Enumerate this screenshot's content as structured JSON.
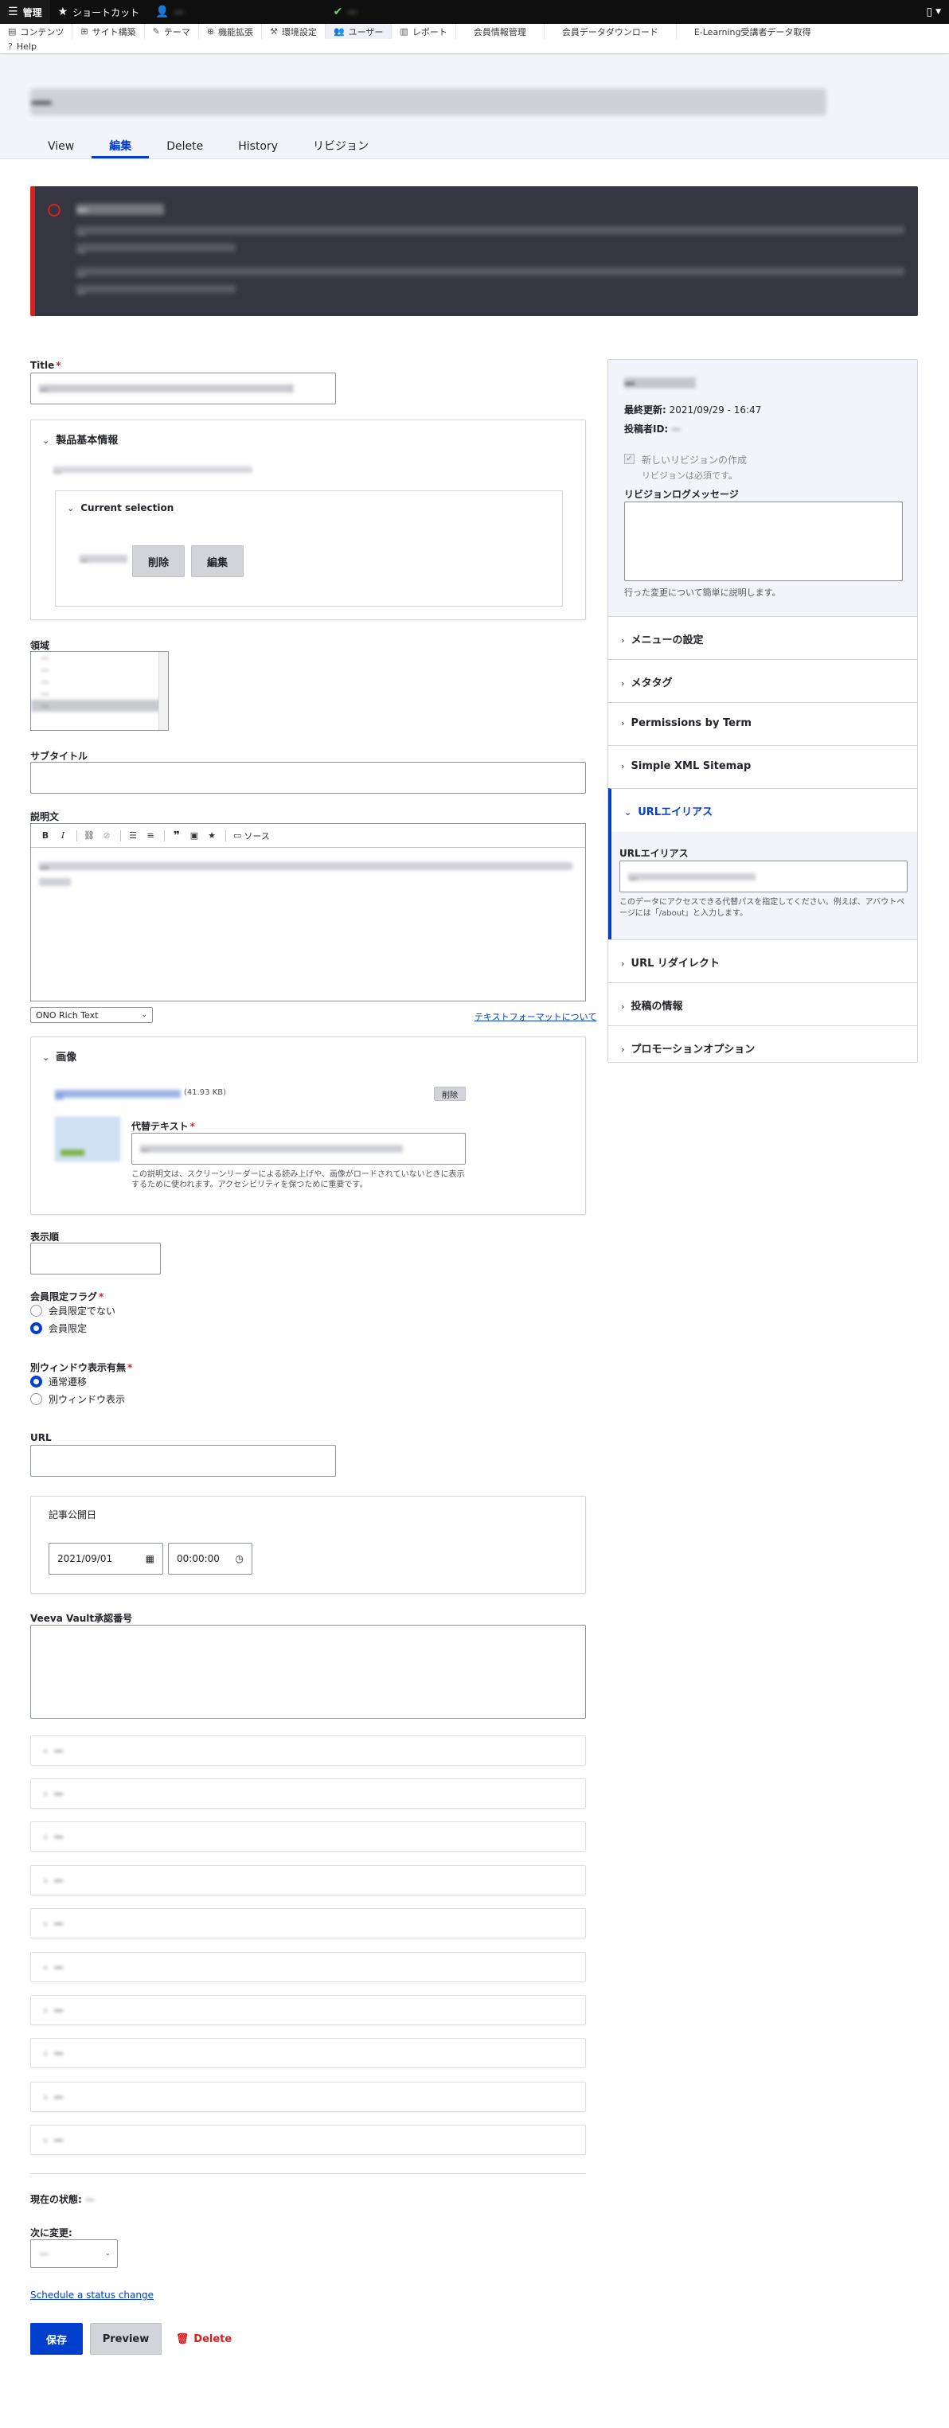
{
  "toolbar": {
    "manage": "管理",
    "shortcuts": "ショートカット",
    "user": "—",
    "subscription": "—",
    "tray_row1": [
      "コンテンツ",
      "サイト構築",
      "テーマ",
      "機能拡張",
      "環境設定",
      "ユーザー",
      "レポート",
      "会員情報管理",
      "会員データダウンロード",
      "E-Learning受講者データ取得"
    ],
    "tray_row2": [
      "Help"
    ]
  },
  "header": {
    "title": "—",
    "tabs": [
      "View",
      "編集",
      "Delete",
      "History",
      "リビジョン"
    ]
  },
  "messages": {
    "title": "—",
    "line1": "—",
    "line2": "—",
    "line3": "—",
    "line4": "—"
  },
  "form": {
    "title_label": "Title",
    "title_value": "—",
    "product_info": {
      "summary": "製品基本情報",
      "help": "—",
      "current_selection": "Current selection",
      "selected_item": "—",
      "remove": "削除",
      "edit": "編集"
    },
    "field_area": {
      "label": "領域",
      "options": [
        "—",
        "—",
        "—",
        "—",
        "—"
      ]
    },
    "subtitle_label": "サブタイトル",
    "description": {
      "label": "説明文",
      "source": "ソース",
      "body": "—",
      "format": "ONO Rich Text",
      "format_link": "テキストフォーマットについて"
    },
    "image": {
      "summary": "画像",
      "file_link": "—",
      "file_size": "(41.93 KB)",
      "remove": "削除",
      "alt_label": "代替テキスト",
      "alt_value": "—",
      "alt_help": "この説明文は、スクリーンリーダーによる読み上げや、画像がロードされていないときに表示するために使われます。アクセシビリティを保つために重要です。"
    },
    "display_order_label": "表示順",
    "member_flag": {
      "label": "会員限定フラグ",
      "options": [
        "会員限定でない",
        "会員限定"
      ],
      "selected": 1
    },
    "new_window": {
      "label": "別ウィンドウ表示有無",
      "options": [
        "通常遷移",
        "別ウィンドウ表示"
      ],
      "selected": 0
    },
    "url_label": "URL",
    "publish_date": {
      "summary": "記事公開日",
      "date": "2021/09/01",
      "time": "00:00:00"
    },
    "veeva_label": "Veeva Vault承認番号",
    "groups": [
      "—",
      "—",
      "—",
      "—",
      "—",
      "—",
      "—",
      "—",
      "—",
      "—"
    ],
    "current_state_label": "現在の状態:",
    "current_state_value": "—",
    "next_state_label": "次に変更:",
    "next_state_value": "—",
    "schedule_link": "Schedule a status change",
    "save": "保存",
    "preview": "Preview",
    "delete": "Delete"
  },
  "sidebar": {
    "status": "—",
    "last_updated_label": "最終更新:",
    "last_updated_value": "2021/09/29 - 16:47",
    "author_label": "投稿者ID:",
    "author_value": "—",
    "new_revision": "新しいリビジョンの作成",
    "new_revision_help": "リビジョンは必須です。",
    "log_label": "リビジョンログメッセージ",
    "log_help": "行った変更について簡単に説明します。",
    "sections": [
      "メニューの設定",
      "メタタグ",
      "Permissions by Term",
      "Simple XML Sitemap",
      "URLエイリアス",
      "URL リダイレクト",
      "投稿の情報",
      "プロモーションオプション"
    ],
    "alias_label": "URLエイリアス",
    "alias_value": "—",
    "alias_help": "このデータにアクセスできる代替パスを指定してください。例えば、アバウトページには「/about」と入力します。"
  },
  "colors": {
    "accent": "#003ecc",
    "error": "#d72222",
    "toolbar": "#0f0f0f"
  }
}
